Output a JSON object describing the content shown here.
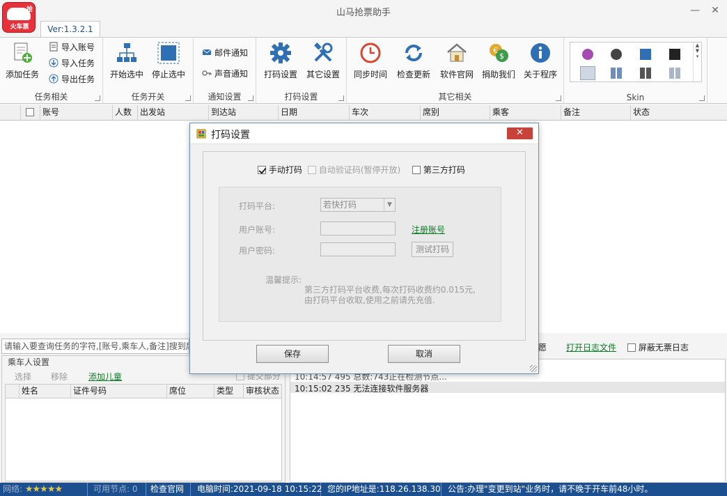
{
  "app": {
    "title": "山马抢票助手",
    "version_tab": "Ver:1.3.2.1",
    "logo_text": "火车票",
    "logo_badge": "抢",
    "minimize": "—",
    "close": "✕"
  },
  "ribbon": {
    "task_group": {
      "label": "任务相关",
      "add_task": "添加任务",
      "import_account": "导入账号",
      "import_task": "导入任务",
      "export_task": "导出任务"
    },
    "switch_group": {
      "label": "任务开关",
      "start": "开始选中",
      "stop": "停止选中"
    },
    "notify_group": {
      "label": "通知设置",
      "email": "邮件通知",
      "sound": "声音通知"
    },
    "captcha_group": {
      "label": "打码设置",
      "captcha": "打码设置",
      "other": "其它设置"
    },
    "other_group": {
      "label": "其它相关",
      "sync_time": "同步时间",
      "check_update": "检查更新",
      "website": "软件官网",
      "donate": "捐助我们",
      "about": "关于程序"
    },
    "skin_group": {
      "label": "Skin"
    }
  },
  "task_table": {
    "columns": [
      "账号",
      "人数",
      "出发站",
      "到达站",
      "日期",
      "车次",
      "席别",
      "乘客",
      "备注",
      "状态"
    ]
  },
  "search": {
    "placeholder": "请输入要查询任务的字符,[账号,乘车人,备注]搜到后",
    "fragment": "愿",
    "open_log": "打开日志文件",
    "hide_no_ticket": "屏蔽无票日志"
  },
  "passenger": {
    "title": "乘车人设置",
    "select": "选择",
    "remove": "移除",
    "add_child": "添加儿童",
    "submit_partial": "提交部分",
    "columns": [
      "姓名",
      "证件号码",
      "席位",
      "类型",
      "审核状态"
    ]
  },
  "log": {
    "lines": [
      "10:14:57 495 总数:743正在检测节点...",
      "10:15:02 235 无法连接软件服务器"
    ]
  },
  "statusbar": {
    "network": "网络:",
    "stars": "★★★★★",
    "nodes": "可用节点: 0",
    "check_site": "检查官网",
    "time": "电脑时间:2021-09-18 10:15:22",
    "ip": "您的IP地址是:118.26.138.30",
    "notice": "公告:办理\"变更到站\"业务时，请不晚于开车前48小时。"
  },
  "dialog": {
    "title": "打码设置",
    "close": "✕",
    "manual": "手动打码",
    "auto": "自动验证码(暂停开放)",
    "third_party": "第三方打码",
    "platform_label": "打码平台:",
    "platform_value": "若快打码",
    "user_label": "用户账号:",
    "register": "注册账号",
    "password_label": "用户密码:",
    "test": "测试打码",
    "hint_label": "温馨提示:",
    "hint_line1": "第三方打码平台收费,每次打码收费约0.015元,",
    "hint_line2": "由打码平台收取,使用之前请先充值.",
    "save": "保存",
    "cancel": "取消"
  },
  "colors": {
    "accent_blue": "#1c4f8f",
    "link_green": "#0a7d23",
    "close_red": "#c7423a",
    "logo_red": "#e8303a"
  }
}
